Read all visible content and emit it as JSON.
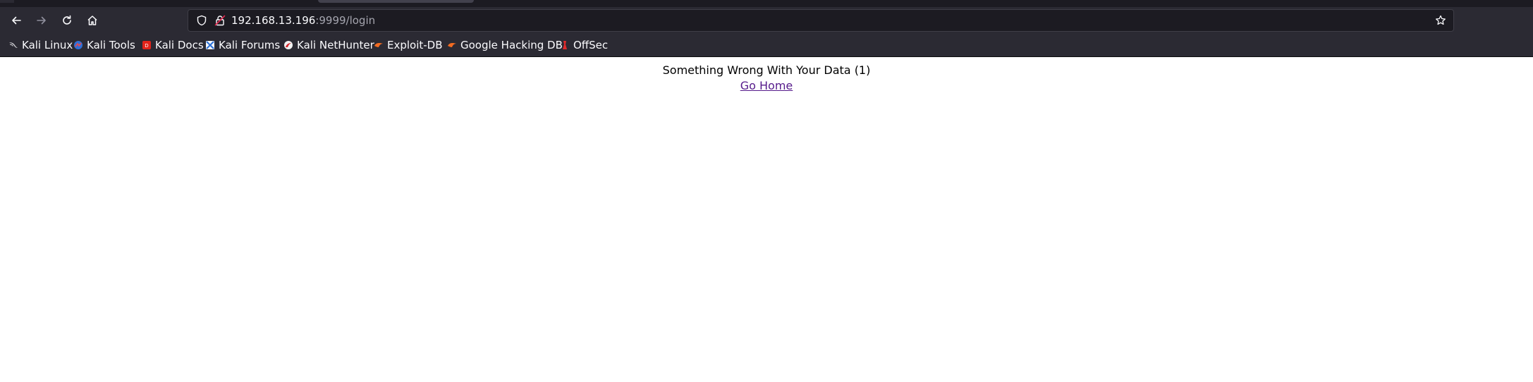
{
  "browser": {
    "url_host": "192.168.13.196",
    "url_rest": ":9999/login",
    "bookmarks": [
      {
        "label": "Kali Linux",
        "icon": "kali-dragon-icon"
      },
      {
        "label": "Kali Tools",
        "icon": "kali-tools-icon"
      },
      {
        "label": "Kali Docs",
        "icon": "kali-docs-icon"
      },
      {
        "label": "Kali Forums",
        "icon": "kali-forums-icon"
      },
      {
        "label": "Kali NetHunter",
        "icon": "nethunter-icon"
      },
      {
        "label": "Exploit-DB",
        "icon": "exploit-db-icon"
      },
      {
        "label": "Google Hacking DB",
        "icon": "ghdb-icon"
      },
      {
        "label": "OffSec",
        "icon": "offsec-icon"
      }
    ],
    "colors": {
      "chrome_bg": "#2b2a33",
      "urlbar_bg": "#1c1b22",
      "text": "#fbfbfe",
      "link": "#551a8b"
    }
  },
  "page": {
    "message": "Something Wrong With Your Data (1)",
    "link_text": "Go Home"
  }
}
